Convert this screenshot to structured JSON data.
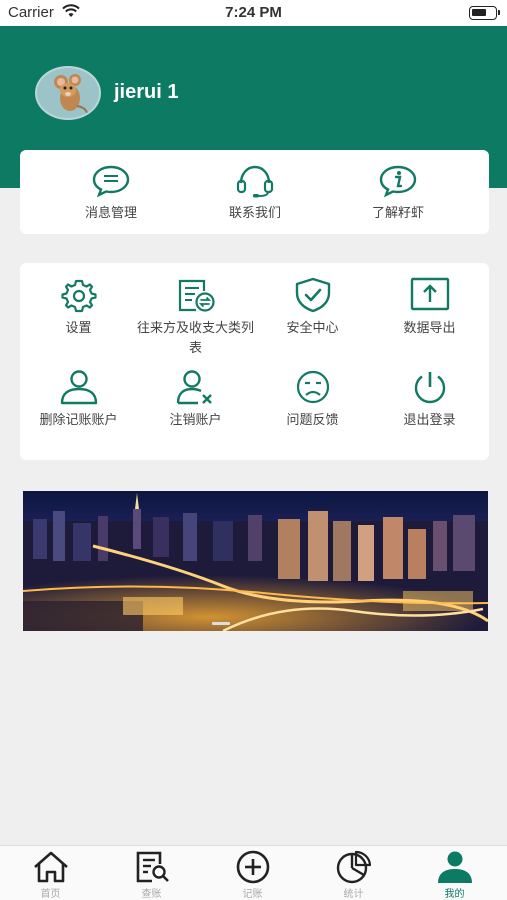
{
  "status_bar": {
    "carrier": "Carrier",
    "time": "7:24 PM"
  },
  "profile": {
    "username": "jierui 1"
  },
  "quick_links": [
    {
      "label": "消息管理",
      "icon": "chat-bubble-icon"
    },
    {
      "label": "联系我们",
      "icon": "headset-icon"
    },
    {
      "label": "了解籽虾",
      "icon": "info-bubble-icon"
    }
  ],
  "menu": [
    {
      "label": "设置",
      "icon": "gear-icon"
    },
    {
      "label": "往来方及收支大类列表",
      "icon": "list-exchange-icon"
    },
    {
      "label": "安全中心",
      "icon": "shield-check-icon"
    },
    {
      "label": "数据导出",
      "icon": "export-icon"
    },
    {
      "label": "删除记账账户",
      "icon": "user-icon"
    },
    {
      "label": "注销账户",
      "icon": "user-remove-icon"
    },
    {
      "label": "问题反馈",
      "icon": "sad-face-icon"
    },
    {
      "label": "退出登录",
      "icon": "power-icon"
    }
  ],
  "tabs": [
    {
      "label": "首页",
      "icon": "home-icon",
      "active": false
    },
    {
      "label": "查账",
      "icon": "search-ledger-icon",
      "active": false
    },
    {
      "label": "记账",
      "icon": "add-circle-icon",
      "active": false
    },
    {
      "label": "统计",
      "icon": "pie-chart-icon",
      "active": false
    },
    {
      "label": "我的",
      "icon": "person-icon",
      "active": true
    }
  ],
  "colors": {
    "brand": "#0d7a63",
    "icon": "#127a63",
    "background": "#efefef"
  }
}
